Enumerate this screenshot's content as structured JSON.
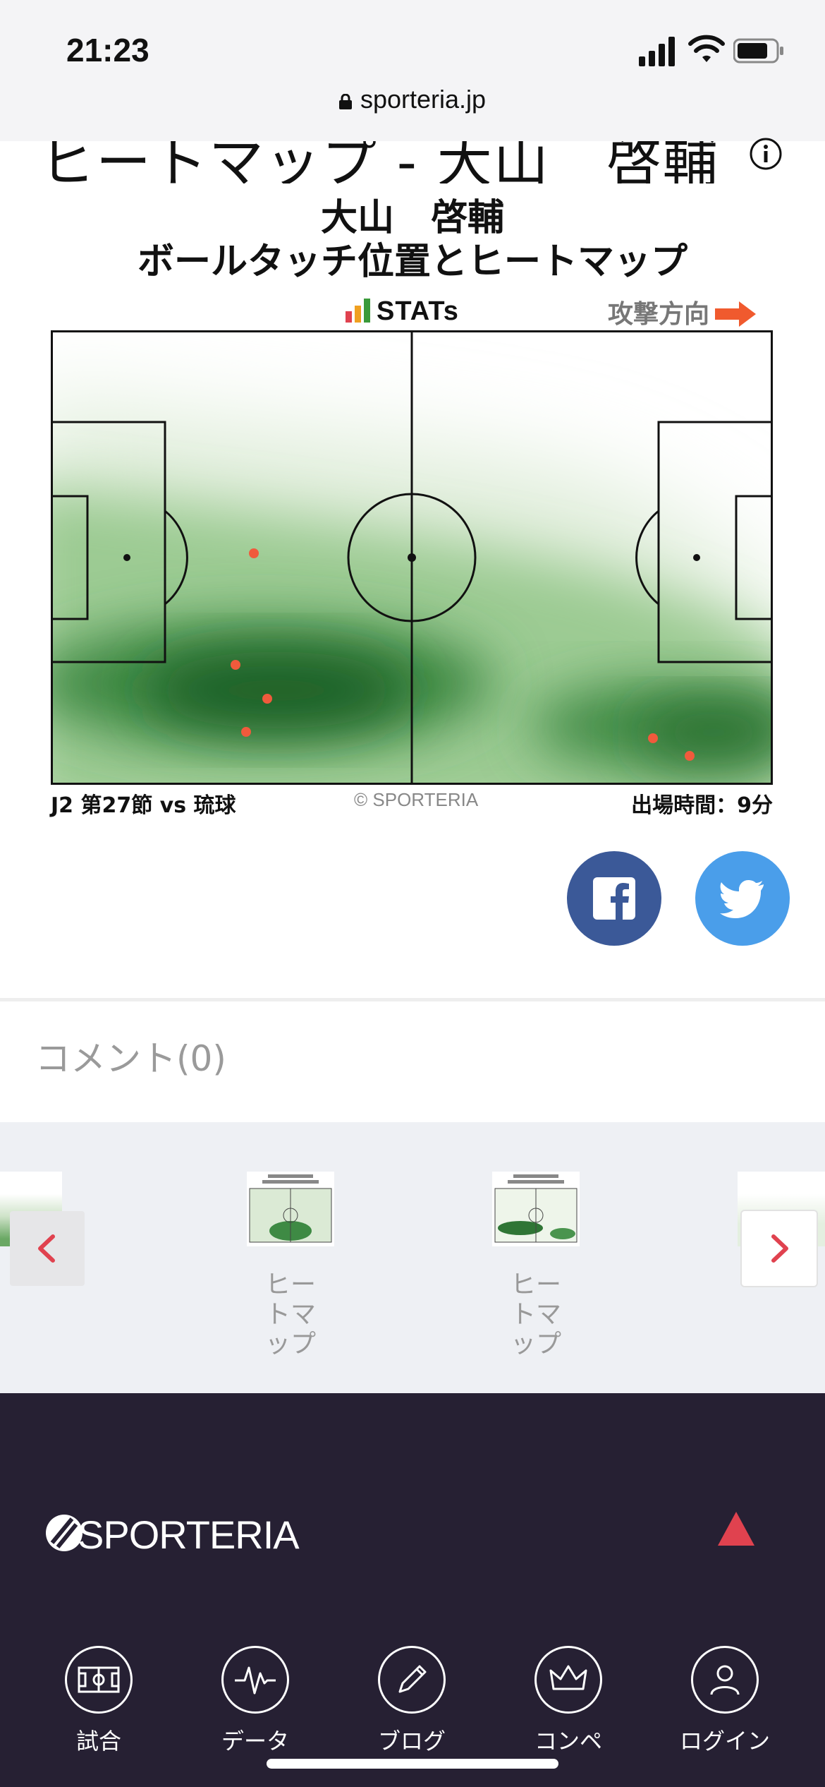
{
  "status_bar": {
    "time": "21:23"
  },
  "browser": {
    "url": "sporteria.jp"
  },
  "page": {
    "header_title": "ヒートマップ - 大山　啓輔"
  },
  "heatmap_card": {
    "title_line1": "大山　啓輔",
    "title_line2": "ボールタッチ位置とヒートマップ",
    "logo_text": "STATs",
    "attack_direction": "攻撃方向",
    "match_label": "J2 第27節 vs 琉球",
    "copyright": "© SPORTERIA",
    "playing_time": "出場時間：9分",
    "colors": {
      "heat": "#1e6b2a",
      "touch": "#f05a3c",
      "arrow": "#f05a2e"
    }
  },
  "share": {
    "facebook_icon": "facebook-icon",
    "twitter_icon": "twitter-icon",
    "facebook_color": "#3b5998",
    "twitter_color": "#4a9eea"
  },
  "comments": {
    "label": "コメント(0)"
  },
  "carousel": {
    "slides": [
      {
        "label": "ヒー\nトマ\nップ"
      },
      {
        "label": "ヒー\nトマ\nップ"
      }
    ],
    "prev_icon": "chevron-left-icon",
    "next_icon": "chevron-right-icon"
  },
  "footer": {
    "brand": "SPORTERIA",
    "tabs": [
      {
        "label": "試合",
        "icon": "pitch-icon"
      },
      {
        "label": "データ",
        "icon": "pulse-icon"
      },
      {
        "label": "ブログ",
        "icon": "pencil-icon"
      },
      {
        "label": "コンペ",
        "icon": "crown-icon"
      },
      {
        "label": "ログイン",
        "icon": "user-icon"
      }
    ],
    "accent": "#e0424f"
  }
}
